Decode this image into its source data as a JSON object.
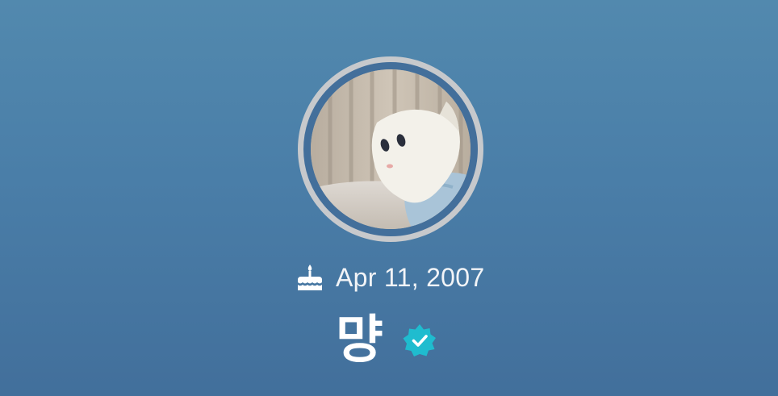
{
  "profile": {
    "avatar_icon": "avatar-plush-cat",
    "birthday_icon": "cake-icon",
    "birthday_text": "Apr 11, 2007",
    "display_name": "먕",
    "verified_icon": "verified-badge-icon",
    "colors": {
      "background_top": "#5289ae",
      "background_bottom": "#426f9b",
      "avatar_ring": "#c7c9cc",
      "verified_badge": "#1fbccf",
      "text": "#f2f4f7"
    }
  }
}
